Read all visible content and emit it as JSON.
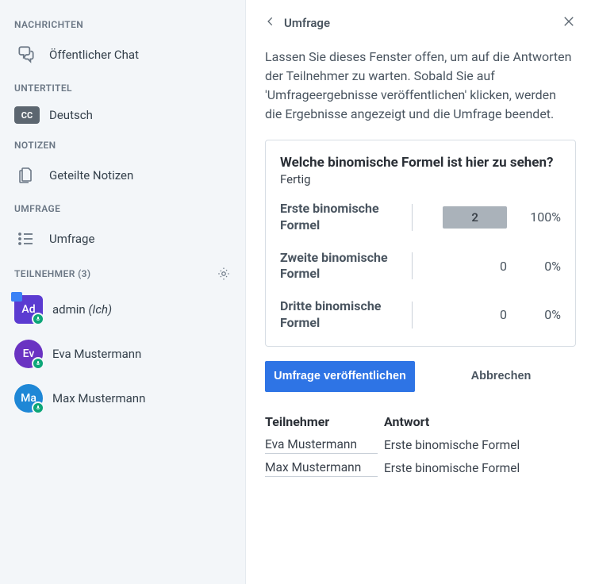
{
  "sidebar": {
    "sections": {
      "messages": {
        "header": "NACHRICHTEN",
        "chat_label": "Öffentlicher Chat"
      },
      "subtitles": {
        "header": "UNTERTITEL",
        "cc_label": "CC",
        "lang": "Deutsch"
      },
      "notes": {
        "header": "NOTIZEN",
        "shared_label": "Geteilte Notizen"
      },
      "poll": {
        "header": "UMFRAGE",
        "item_label": "Umfrage"
      },
      "participants": {
        "header": "TEILNEHMER (3)",
        "items": [
          {
            "initials": "Ad",
            "name": "admin",
            "suffix": "(Ich)",
            "color": "#5b3bd1",
            "square": true,
            "presenter": true
          },
          {
            "initials": "Ev",
            "name": "Eva Mustermann",
            "suffix": "",
            "color": "#6a33c2",
            "square": false,
            "presenter": false
          },
          {
            "initials": "Ma",
            "name": "Max Mustermann",
            "suffix": "",
            "color": "#1e87d6",
            "square": false,
            "presenter": false
          }
        ]
      }
    }
  },
  "panel": {
    "title": "Umfrage",
    "intro": "Lassen Sie dieses Fenster offen, um auf die Antworten der Teilnehmer zu warten. Sobald Sie auf 'Umfrageergebnisse veröffentlichen' klicken, werden die Ergebnisse angezeigt und die Umfrage beendet.",
    "poll": {
      "question": "Welche binomische Formel ist hier zu sehen?",
      "status": "Fertig",
      "results": [
        {
          "label": "Erste binomische Formel",
          "count": "2",
          "pct": "100%",
          "highlight": true
        },
        {
          "label": "Zweite binomische Formel",
          "count": "0",
          "pct": "0%",
          "highlight": false
        },
        {
          "label": "Dritte binomische Formel",
          "count": "0",
          "pct": "0%",
          "highlight": false
        }
      ]
    },
    "buttons": {
      "publish": "Umfrage veröffentlichen",
      "cancel": "Abbrechen"
    },
    "responses": {
      "hdr_participant": "Teilnehmer",
      "hdr_answer": "Antwort",
      "rows": [
        {
          "name": "Eva Mustermann",
          "answer": "Erste binomische Formel"
        },
        {
          "name": "Max Mustermann",
          "answer": "Erste binomische Formel"
        }
      ]
    }
  }
}
